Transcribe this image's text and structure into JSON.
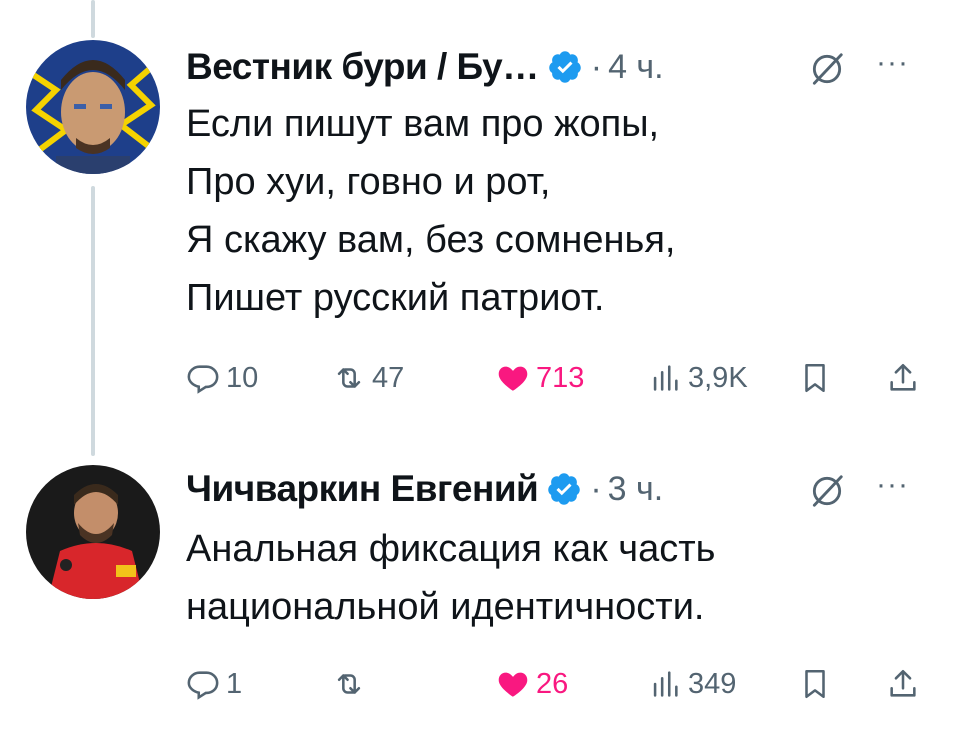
{
  "tweets": [
    {
      "author": "Вестник бури / Бу…",
      "time": "4 ч.",
      "lines": [
        "Если пишут вам про жопы,",
        "Про хуи, говно и рот,",
        "Я скажу вам, без сомненья,",
        "Пишет русский патриот."
      ],
      "replies": "10",
      "reposts": "47",
      "likes": "713",
      "views": "3,9K"
    },
    {
      "author": "Чичваркин Евгений",
      "time": "3 ч.",
      "lines": [
        "Анальная фиксация как часть",
        "национальной идентичности."
      ],
      "replies": "1",
      "reposts": "",
      "likes": "26",
      "views": "349"
    }
  ],
  "ui": {
    "dot": "·",
    "more": "···"
  },
  "colors": {
    "verified": "#1d9bf0",
    "like": "#f91880",
    "muted": "#536471",
    "thread_line": "#cfd9de"
  }
}
